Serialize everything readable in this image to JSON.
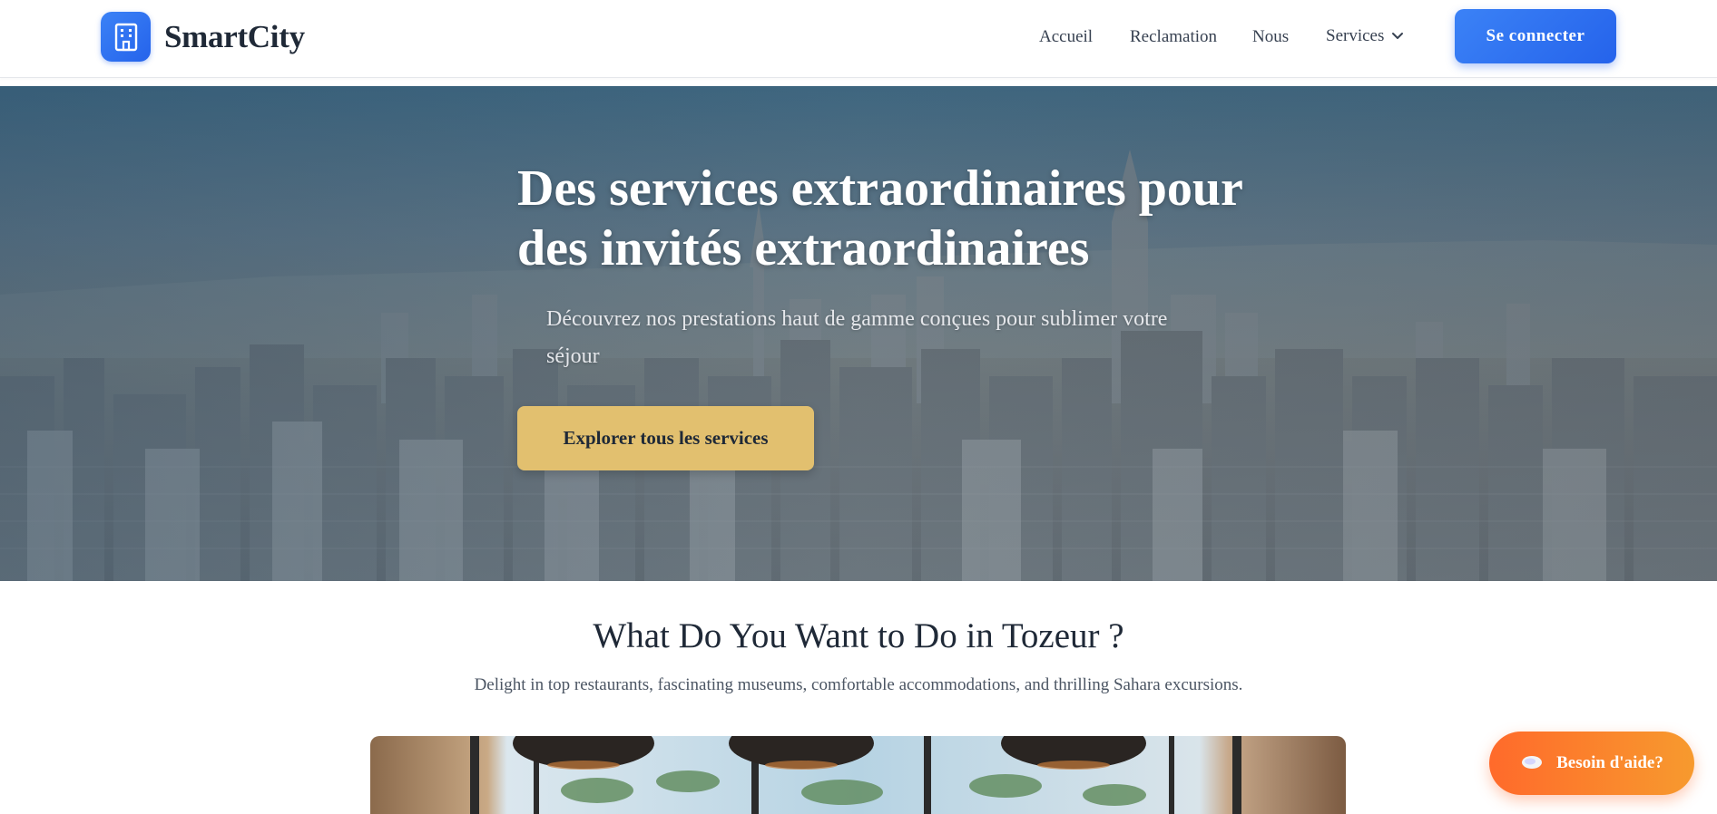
{
  "header": {
    "brand_name": "SmartCity",
    "nav": {
      "accueil": "Accueil",
      "reclamation": "Reclamation",
      "nous": "Nous",
      "services": "Services"
    },
    "login_label": "Se connecter"
  },
  "hero": {
    "title": "Des services extraordinaires pour des invités extraordinaires",
    "subtitle": "Découvrez nos prestations haut de gamme conçues pour sublimer votre séjour",
    "cta_label": "Explorer tous les services"
  },
  "section": {
    "title": "What Do You Want to Do in Tozeur ?",
    "subtitle": "Delight in top restaurants, fascinating museums, comfortable accommodations, and thrilling Sahara excursions."
  },
  "help": {
    "label": "Besoin d'aide?"
  },
  "colors": {
    "primary": "#2563eb",
    "accent_gold": "#e2c06f",
    "help_orange": "#ff6a2b"
  },
  "icons": {
    "brand": "building-icon",
    "dropdown": "chevron-down-icon",
    "help": "chat-bubble-icon"
  }
}
